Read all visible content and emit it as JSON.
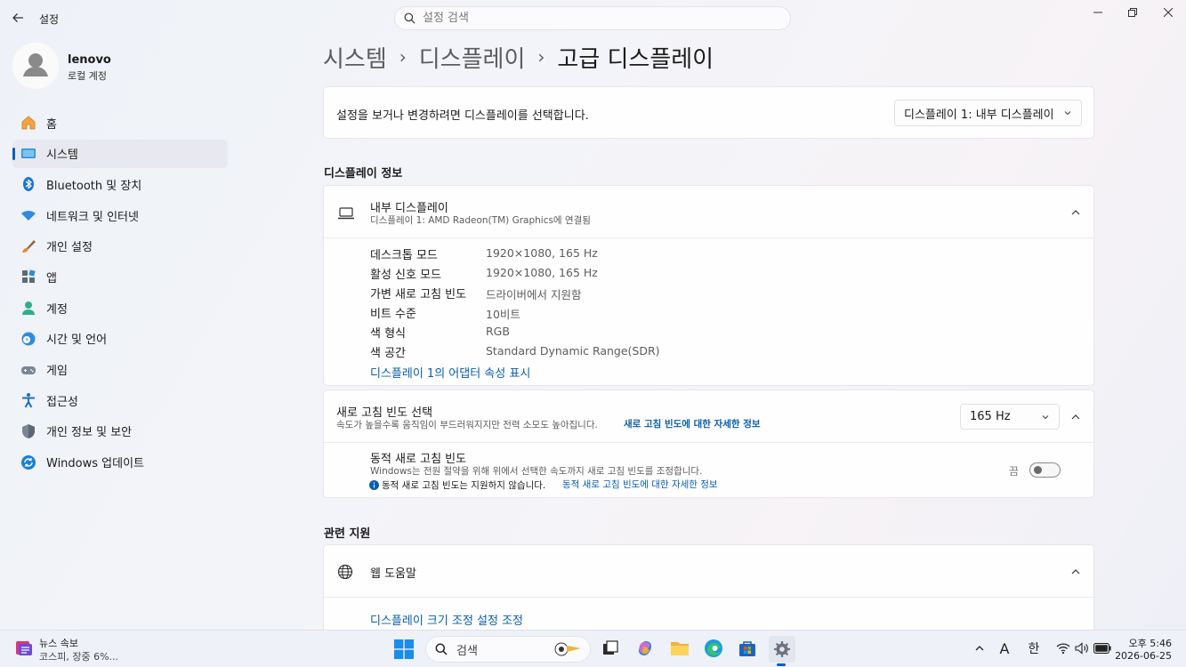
{
  "window": {
    "app_title": "설정",
    "search_placeholder": "설정 검색"
  },
  "user": {
    "name": "lenovo",
    "account_type": "로컬 계정"
  },
  "sidebar": {
    "items": [
      {
        "label": "홈",
        "icon": "home-icon"
      },
      {
        "label": "시스템",
        "icon": "system-icon",
        "active": true
      },
      {
        "label": "Bluetooth 및 장치",
        "icon": "bluetooth-icon"
      },
      {
        "label": "네트워크 및 인터넷",
        "icon": "wifi-icon"
      },
      {
        "label": "개인 설정",
        "icon": "brush-icon"
      },
      {
        "label": "앱",
        "icon": "apps-icon"
      },
      {
        "label": "계정",
        "icon": "account-icon"
      },
      {
        "label": "시간 및 언어",
        "icon": "globe-clock-icon"
      },
      {
        "label": "게임",
        "icon": "gamepad-icon"
      },
      {
        "label": "접근성",
        "icon": "accessibility-icon"
      },
      {
        "label": "개인 정보 및 보안",
        "icon": "shield-icon"
      },
      {
        "label": "Windows 업데이트",
        "icon": "update-icon"
      }
    ]
  },
  "breadcrumb": {
    "level1": "시스템",
    "level2": "디스플레이",
    "current": "고급 디스플레이",
    "separator": "›"
  },
  "display_select": {
    "prompt": "설정을 보거나 변경하려면 디스플레이를 선택합니다.",
    "selected": "디스플레이 1: 내부 디스플레이"
  },
  "display_info": {
    "section_title": "디스플레이 정보",
    "title": "내부 디스플레이",
    "subtitle": "디스플레이 1: AMD Radeon(TM) Graphics에 연결됨",
    "rows": [
      {
        "label": "데스크톱 모드",
        "value": "1920×1080, 165 Hz"
      },
      {
        "label": "활성 신호 모드",
        "value": "1920×1080, 165 Hz"
      },
      {
        "label": "가변 새로 고침 빈도",
        "value": "드라이버에서 지원함"
      },
      {
        "label": "비트 수준",
        "value": "10비트"
      },
      {
        "label": "색 형식",
        "value": "RGB"
      },
      {
        "label": "색 공간",
        "value": "Standard Dynamic Range(SDR)"
      }
    ],
    "adapter_link": "디스플레이 1의 어댑터 속성 표시"
  },
  "refresh_rate": {
    "title": "새로 고침 빈도 선택",
    "description": "속도가 높을수록 움직임이 부드러워지지만 전력 소모도 높아집니다.",
    "learn_more": "새로 고침 빈도에 대한 자세한 정보",
    "selected": "165 Hz",
    "dynamic": {
      "title": "동적 새로 고침 빈도",
      "description": "Windows는 전원 절약을 위해 위에서 선택한 속도까지 새로 고침 빈도를 조정합니다.",
      "not_supported": "동적 새로 고침 빈도는 지원하지 않습니다.",
      "learn_more": "동적 새로 고침 빈도에 대한 자세한 정보",
      "state_label": "끔",
      "enabled": false
    }
  },
  "related_support": {
    "section_title": "관련 지원",
    "web_help": "웹 도움말",
    "link1": "디스플레이 크기 조정 설정 조정"
  },
  "taskbar": {
    "news_title": "뉴스 속보",
    "news_sub": "코스피, 장중 6%...",
    "search_label": "검색",
    "ime_a": "A",
    "ime_lang": "한",
    "time": "오후 5:46",
    "date": "2026-06-25"
  },
  "colors": {
    "accent": "#005fb8",
    "link": "#0a5dab"
  }
}
